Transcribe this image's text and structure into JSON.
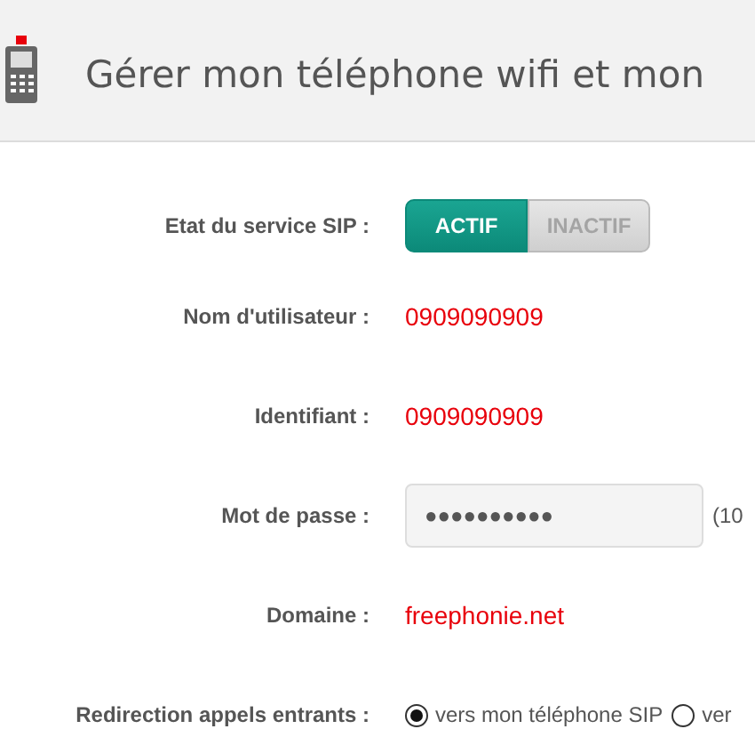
{
  "header": {
    "title": "Gérer mon téléphone wifi et mon"
  },
  "form": [
    {
      "kind": "toggle",
      "label": "Etat du service SIP :",
      "options": [
        {
          "label": "ACTIF",
          "selected": true
        },
        {
          "label": "INACTIF",
          "selected": false
        }
      ]
    },
    {
      "kind": "value",
      "label": "Nom d'utilisateur :",
      "value": "0909090909"
    },
    {
      "kind": "value",
      "label": "Identifiant :",
      "value": "0909090909"
    },
    {
      "kind": "password",
      "label": "Mot de passe :",
      "value": "●●●●●●●●●●",
      "note": "(10"
    },
    {
      "kind": "value",
      "label": "Domaine :",
      "value": "freephonie.net"
    },
    {
      "kind": "radio",
      "label": "Redirection appels entrants :",
      "options": [
        {
          "label": "vers mon téléphone SIP",
          "selected": true
        },
        {
          "label": "ver",
          "selected": false
        }
      ]
    }
  ]
}
